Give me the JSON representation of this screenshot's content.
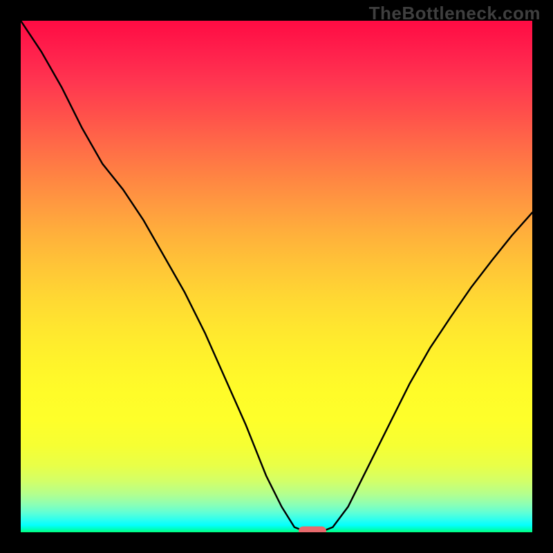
{
  "watermark": "TheBottleneck.com",
  "chart_data": {
    "type": "line",
    "title": "",
    "xlabel": "",
    "ylabel": "",
    "xlim": [
      0,
      1
    ],
    "ylim": [
      0,
      1
    ],
    "grid": false,
    "series": [
      {
        "name": "bottleneck-curve",
        "x": [
          0.0,
          0.04,
          0.08,
          0.12,
          0.16,
          0.2,
          0.24,
          0.28,
          0.32,
          0.36,
          0.4,
          0.44,
          0.48,
          0.51,
          0.535,
          0.56,
          0.585,
          0.61,
          0.64,
          0.68,
          0.72,
          0.76,
          0.8,
          0.84,
          0.88,
          0.92,
          0.96,
          1.0
        ],
        "y": [
          1.0,
          0.94,
          0.87,
          0.79,
          0.72,
          0.67,
          0.61,
          0.54,
          0.47,
          0.39,
          0.3,
          0.21,
          0.11,
          0.05,
          0.01,
          0.0,
          0.0,
          0.01,
          0.05,
          0.13,
          0.21,
          0.29,
          0.36,
          0.42,
          0.478,
          0.53,
          0.58,
          0.625
        ]
      }
    ],
    "marker": {
      "x": 0.57,
      "y": 0.0,
      "color": "#e76a6d"
    },
    "colors": {
      "curve": "#000000",
      "marker": "#e76a6d",
      "gradient_top": "#ff0b43",
      "gradient_mid": "#fffb29",
      "gradient_bottom": "#00ff7d"
    }
  }
}
